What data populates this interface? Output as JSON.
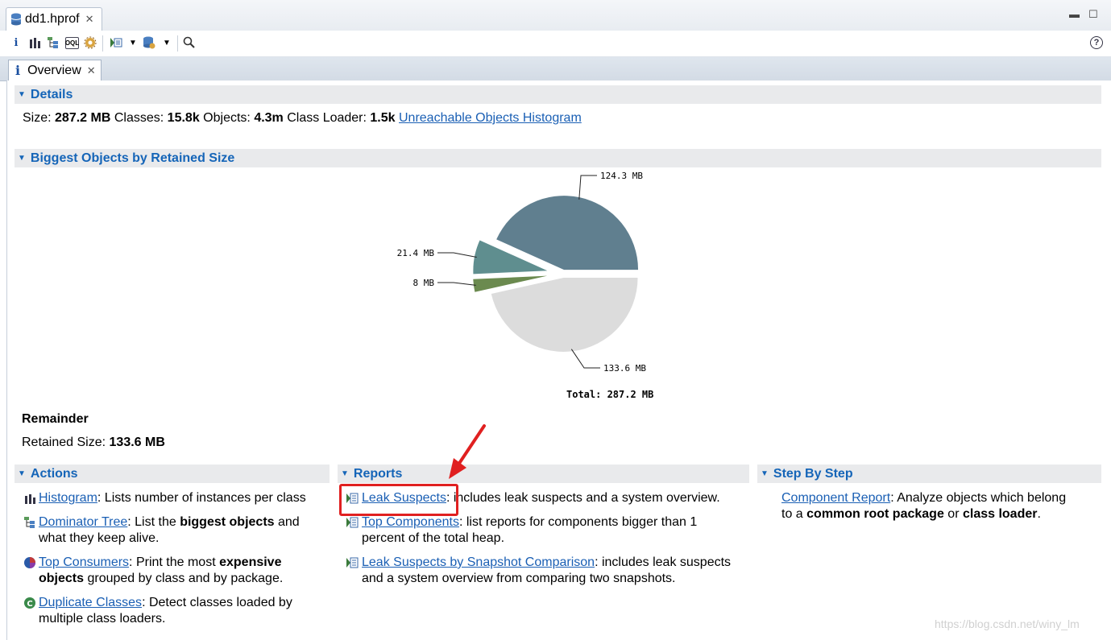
{
  "editor": {
    "tab_title": "dd1.hprof"
  },
  "view": {
    "tab_title": "Overview"
  },
  "details": {
    "header": "Details",
    "size_label": "Size:",
    "size_value": "287.2 MB",
    "classes_label": "Classes:",
    "classes_value": "15.8k",
    "objects_label": "Objects:",
    "objects_value": "4.3m",
    "loader_label": "Class Loader:",
    "loader_value": "1.5k",
    "histogram_link": "Unreachable Objects Histogram"
  },
  "biggest": {
    "header": "Biggest Objects by Retained Size",
    "remainder_title": "Remainder",
    "retained_label": "Retained Size:",
    "retained_value": "133.6 MB"
  },
  "chart_data": {
    "type": "pie",
    "unit": "MB",
    "total_label": "Total:  287.2 MB",
    "slices": [
      {
        "label": "124.3 MB",
        "value": 124.3,
        "color": "#607f8f"
      },
      {
        "label": "21.4 MB",
        "value": 21.4,
        "color": "#5f8e8f"
      },
      {
        "label": "8 MB",
        "value": 8.0,
        "color": "#6b8a4f"
      },
      {
        "label": "133.6 MB",
        "value": 133.6,
        "color": "#dcdcdc"
      }
    ]
  },
  "actions": {
    "header": "Actions",
    "histogram_link": "Histogram",
    "histogram_desc": ": Lists number of instances per class",
    "dominator_link": "Dominator Tree",
    "dominator_desc1": ": List the ",
    "dominator_bold": "biggest objects",
    "dominator_desc2": " and",
    "dominator_desc3": "what they keep alive.",
    "consumers_link": "Top Consumers",
    "consumers_desc1": ": Print the most ",
    "consumers_bold1": "expensive",
    "consumers_bold2": "objects",
    "consumers_desc2": " grouped by class and by package.",
    "duplicate_link": "Duplicate Classes",
    "duplicate_desc1": ": Detect classes loaded by",
    "duplicate_desc2": "multiple class loaders."
  },
  "reports": {
    "header": "Reports",
    "leak_link": "Leak Suspects",
    "leak_desc": ": includes leak suspects and a system overview.",
    "components_link": "Top Components",
    "components_desc1": ": list reports for components bigger than 1",
    "components_desc2": "percent of the total heap.",
    "snapshot_link": "Leak Suspects by Snapshot Comparison",
    "snapshot_desc1": ": includes leak suspects",
    "snapshot_desc2": "and a system overview from comparing two snapshots."
  },
  "steps": {
    "header": "Step By Step",
    "component_link": "Component Report",
    "component_desc1": ": Analyze objects which belong",
    "component_desc2a": "to a ",
    "component_bold1": "common root package",
    "component_desc2b": " or ",
    "component_bold2": "class loader",
    "component_desc2c": "."
  },
  "watermark": "https://blog.csdn.net/winy_lm",
  "colors": {
    "accent": "#1565b8",
    "link": "#1a5fb4",
    "highlight": "#e02020"
  }
}
